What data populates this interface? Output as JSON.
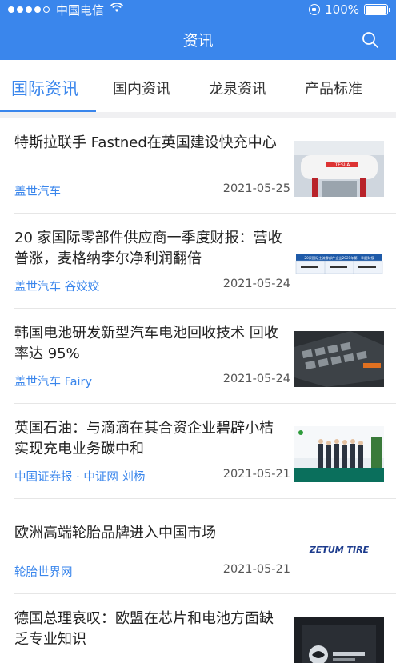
{
  "status": {
    "carrier": "中国电信",
    "battery": "100%"
  },
  "header": {
    "title": "资讯"
  },
  "tabs": [
    {
      "label": "国际资讯",
      "active": true
    },
    {
      "label": "国内资讯",
      "active": false
    },
    {
      "label": "龙泉资讯",
      "active": false
    },
    {
      "label": "产品标准",
      "active": false
    }
  ],
  "articles": [
    {
      "title": "特斯拉联手 Fastned在英国建设快充中心",
      "source": "盖世汽车",
      "date": "2021-05-25",
      "thumb_text": "TESLA"
    },
    {
      "title": "20 家国际零部件供应商一季度财报：营收普涨，麦格纳李尔净利润翻倍",
      "source": "盖世汽车 谷姣姣",
      "date": "2021-05-24",
      "thumb_text": "20家国际主流零部件企业2021年第一季度财报"
    },
    {
      "title": "韩国电池研发新型汽车电池回收技术 回收率达 95%",
      "source": "盖世汽车 Fairy",
      "date": "2021-05-24",
      "thumb_text": ""
    },
    {
      "title": "英国石油：与滴滴在其合资企业碧辟小桔实现充电业务碳中和",
      "source": "中国证券报 · 中证网 刘杨",
      "date": "2021-05-21",
      "thumb_text": ""
    },
    {
      "title": "欧洲高端轮胎品牌进入中国市场",
      "source": "轮胎世界网",
      "date": "2021-05-21",
      "thumb_text": "ZETUM TIRE"
    },
    {
      "title": "德国总理哀叹：欧盟在芯片和电池方面缺乏专业知识",
      "source": "",
      "date": "",
      "thumb_text": ""
    }
  ]
}
